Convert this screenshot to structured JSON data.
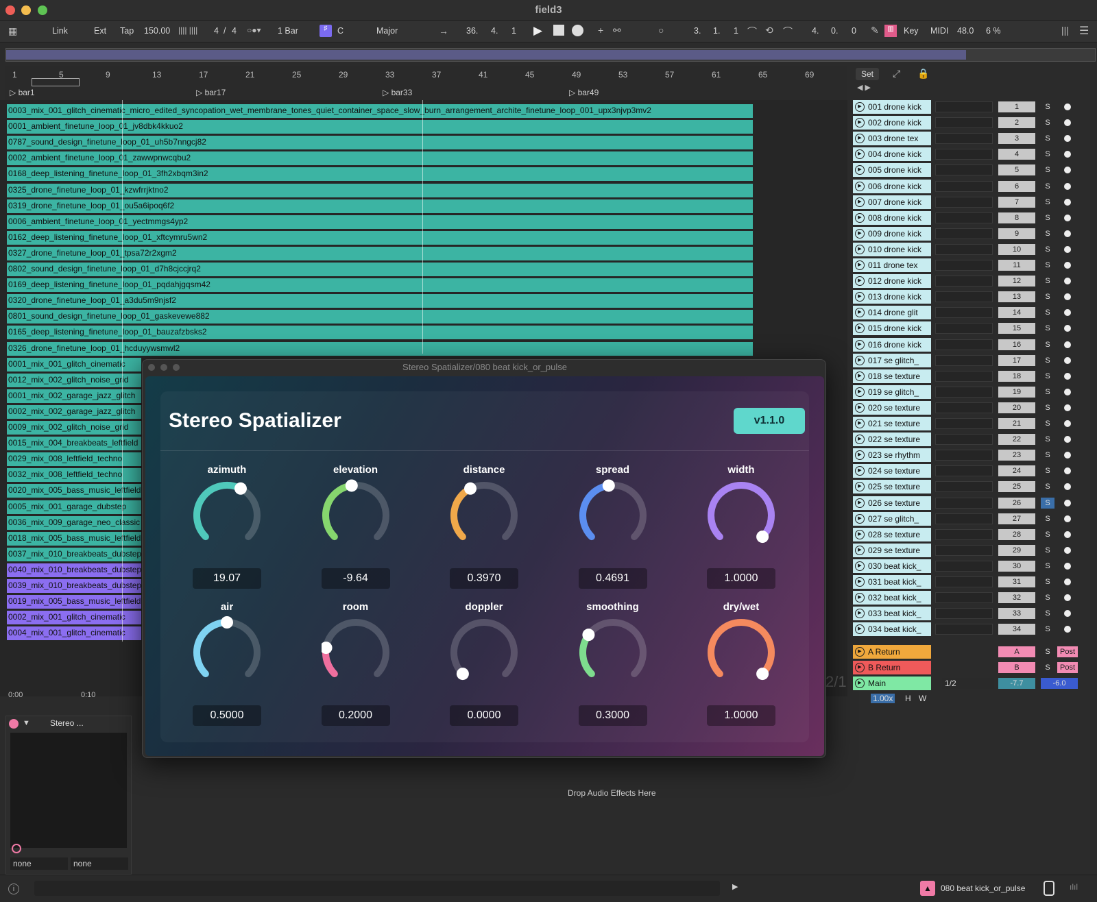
{
  "window": {
    "title": "field3"
  },
  "controlbar": {
    "link": "Link",
    "ext": "Ext",
    "tap": "Tap",
    "tempo": "150.00",
    "sig_num": "4",
    "sig_slash": "/",
    "sig_den": "4",
    "quant": "1 Bar",
    "key": "C",
    "scale": "Major",
    "pos_bar": "36.",
    "pos_beat": "4.",
    "pos_six": "1",
    "loop_bar": "3.",
    "loop_beat": "1.",
    "loop_six": "1",
    "len_bar": "4.",
    "len_beat": "0.",
    "len_six": "0",
    "key_label": "Key",
    "midi_label": "MIDI",
    "cpu_val": "48.0",
    "cpu_pct": "6 %"
  },
  "ruler": {
    "ticks": [
      "1",
      "5",
      "9",
      "13",
      "17",
      "21",
      "25",
      "29",
      "33",
      "37",
      "41",
      "45",
      "49",
      "53",
      "57",
      "61",
      "65",
      "69"
    ],
    "locators": [
      "bar1",
      "bar17",
      "bar33",
      "bar49"
    ],
    "set": "Set"
  },
  "clips": [
    "0003_mix_001_glitch_cinematic_micro_edited_syncopation_wet_membrane_tones_quiet_container_space_slow_burn_arrangement_archite_finetune_loop_001_upx3njvp3mv2",
    "0001_ambient_finetune_loop_01_jv8dbk4kkuo2",
    "0787_sound_design_finetune_loop_01_uh5b7nngcj82",
    "0002_ambient_finetune_loop_01_zawwpnwcqbu2",
    "0168_deep_listening_finetune_loop_01_3fh2xbqm3in2",
    "0325_drone_finetune_loop_01_kzwfrrjktno2",
    "0319_drone_finetune_loop_01_ou5a6ipoq6f2",
    "0006_ambient_finetune_loop_01_yectmmgs4yp2",
    "0162_deep_listening_finetune_loop_01_xftcymru5wn2",
    "0327_drone_finetune_loop_01_tpsa72r2xgm2",
    "0802_sound_design_finetune_loop_01_d7h8cjccjrq2",
    "0169_deep_listening_finetune_loop_01_pqdahjgqsm42",
    "0320_drone_finetune_loop_01_a3du5m9njsf2",
    "0801_sound_design_finetune_loop_01_gaskevewe882",
    "0165_deep_listening_finetune_loop_01_bauzafzbsks2",
    "0326_drone_finetune_loop_01_hcduyywsmwl2",
    "0001_mix_001_glitch_cinematic",
    "0012_mix_002_glitch_noise_grid",
    "0001_mix_002_garage_jazz_glitch",
    "0002_mix_002_garage_jazz_glitch",
    "0009_mix_002_glitch_noise_grid",
    "0015_mix_004_breakbeats_leftfield",
    "0029_mix_008_leftfield_techno",
    "0032_mix_008_leftfield_techno",
    "0020_mix_005_bass_music_leftfield",
    "0005_mix_001_garage_dubstep",
    "0036_mix_009_garage_neo_classic",
    "0018_mix_005_bass_music_leftfield",
    "0037_mix_010_breakbeats_dubstep",
    "0040_mix_010_breakbeats_dubstep",
    "0039_mix_010_breakbeats_dubstep",
    "0019_mix_005_bass_music_leftfield",
    "0002_mix_001_glitch_cinematic",
    "0004_mix_001_glitch_cinematic"
  ],
  "tracks": [
    "001 drone kick",
    "002 drone kick",
    "003 drone tex",
    "004 drone kick",
    "005 drone kick",
    "006 drone kick",
    "007 drone kick",
    "008 drone kick",
    "009 drone kick",
    "010 drone kick",
    "011 drone tex",
    "012 drone kick",
    "013 drone kick",
    "014 drone glit",
    "015 drone kick",
    "016 drone kick",
    "017 se glitch_",
    "018 se texture",
    "019 se glitch_",
    "020 se texture",
    "021 se texture",
    "022 se texture",
    "023 se rhythm",
    "024 se texture",
    "025 se texture",
    "026 se texture",
    "027 se glitch_",
    "028 se texture",
    "029 se texture",
    "030 beat kick_",
    "031 beat kick_",
    "032 beat kick_",
    "033 beat kick_",
    "034 beat kick_"
  ],
  "returns": [
    {
      "name": "A Return",
      "send": "A",
      "mode": "Post",
      "color": "#f0a83c"
    },
    {
      "name": "B Return",
      "send": "B",
      "mode": "Post",
      "color": "#ef5a5a"
    }
  ],
  "main": {
    "name": "Main",
    "routing": "1/2",
    "vol": "-7.7",
    "pan": "-6.0",
    "zoom": "1.00x",
    "h": "H",
    "w": "W",
    "fraction": "2/1"
  },
  "solo": "S",
  "time": {
    "t0": "0:00",
    "t1": "0:10"
  },
  "plugin": {
    "window_title": "Stereo Spatializer/080 beat kick_or_pulse",
    "name": "Stereo Spatializer",
    "version": "v1.1.0",
    "knobs": [
      {
        "label": "azimuth",
        "value": "19.07",
        "norm": 0.6,
        "color": "#4fc9bb"
      },
      {
        "label": "elevation",
        "value": "-9.64",
        "norm": 0.47,
        "color": "#86d66e"
      },
      {
        "label": "distance",
        "value": "0.3970",
        "norm": 0.4,
        "color": "#f0a84a"
      },
      {
        "label": "spread",
        "value": "0.4691",
        "norm": 0.47,
        "color": "#5b8ef0"
      },
      {
        "label": "width",
        "value": "1.0000",
        "norm": 1.0,
        "color": "#a983f2"
      },
      {
        "label": "air",
        "value": "0.5000",
        "norm": 0.5,
        "color": "#7fd3f2"
      },
      {
        "label": "room",
        "value": "0.2000",
        "norm": 0.2,
        "color": "#ef6f9e"
      },
      {
        "label": "doppler",
        "value": "0.0000",
        "norm": 0.0,
        "color": "#888888"
      },
      {
        "label": "smoothing",
        "value": "0.3000",
        "norm": 0.3,
        "color": "#7edc8e"
      },
      {
        "label": "dry/wet",
        "value": "1.0000",
        "norm": 1.0,
        "color": "#f58a5e"
      }
    ]
  },
  "device": {
    "title": "Stereo ...",
    "in1": "none",
    "in2": "none"
  },
  "drop_text": "Drop Audio Effects Here",
  "status": {
    "clip_name": "080 beat kick_or_pulse"
  }
}
